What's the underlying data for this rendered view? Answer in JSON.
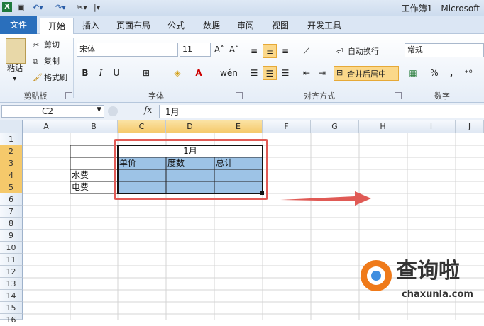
{
  "quick_access": {
    "undo_icon": "undo-icon",
    "redo_icon": "redo-icon",
    "separator": "▾"
  },
  "window": {
    "title": "工作簿1 - Microsoft"
  },
  "tabs": [
    {
      "label": "文件"
    },
    {
      "label": "开始"
    },
    {
      "label": "插入"
    },
    {
      "label": "页面布局"
    },
    {
      "label": "公式"
    },
    {
      "label": "数据"
    },
    {
      "label": "审阅"
    },
    {
      "label": "视图"
    },
    {
      "label": "开发工具"
    }
  ],
  "ribbon": {
    "clipboard": {
      "paste": "粘贴",
      "cut": "剪切",
      "copy": "复制",
      "format_painter": "格式刷",
      "label": "剪贴板"
    },
    "font": {
      "name": "宋体",
      "size": "11",
      "label": "字体",
      "bold": "B",
      "italic": "I",
      "underline": "U"
    },
    "alignment": {
      "wrap": "自动换行",
      "merge": "合并后居中",
      "label": "对齐方式"
    },
    "number": {
      "format": "常规",
      "label": "数字",
      "percent": "%"
    }
  },
  "formula_bar": {
    "name_box": "C2",
    "fx": "fx",
    "value": "1月"
  },
  "grid": {
    "columns": [
      "A",
      "B",
      "C",
      "D",
      "E",
      "F",
      "G",
      "H",
      "I",
      "J"
    ],
    "rows": [
      "1",
      "2",
      "3",
      "4",
      "5",
      "6",
      "7",
      "8",
      "9",
      "10",
      "11",
      "12",
      "13",
      "14",
      "15",
      "16"
    ],
    "cells": {
      "C2": "1月",
      "C3": "单价",
      "D3": "度数",
      "E3": "总计",
      "B4": "水费",
      "B5": "电费"
    }
  },
  "watermark": {
    "brand": "查询啦",
    "url": "chaxunla.com"
  },
  "colors": {
    "accent": "#2a6fbc",
    "selection_fill": "#9dc3e6",
    "highlight": "#e05a55",
    "active_header": "#f5c96b"
  }
}
